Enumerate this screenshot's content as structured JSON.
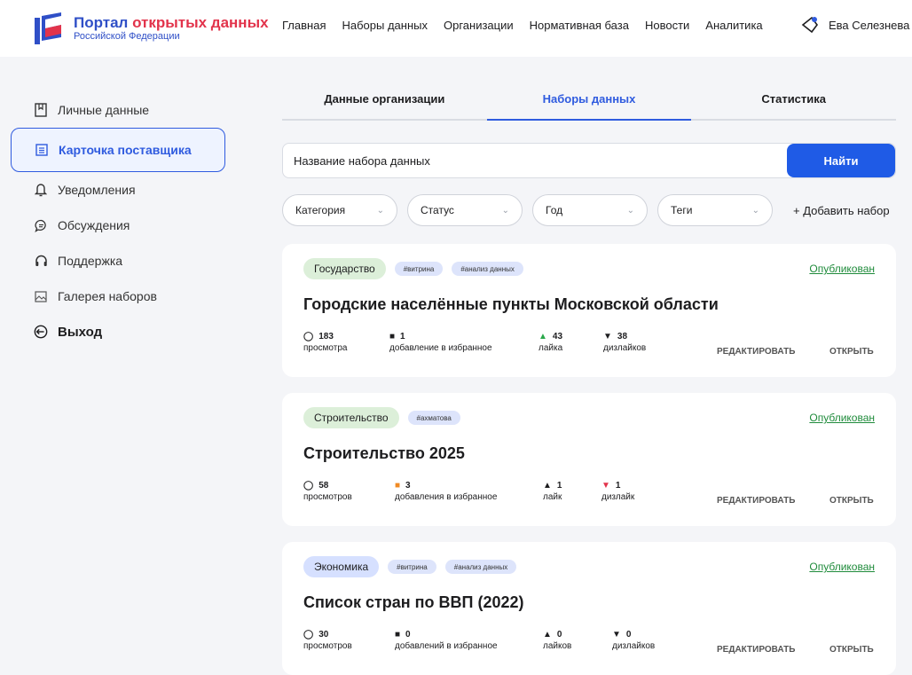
{
  "header": {
    "logo_title_main": "Портал",
    "logo_title_accent": "открытых данных",
    "logo_subtitle": "Российской Федерации",
    "nav": [
      "Главная",
      "Наборы данных",
      "Организации",
      "Нормативная база",
      "Новости",
      "Аналитика"
    ],
    "user_name": "Ева Селезнева"
  },
  "sidebar": {
    "items": [
      {
        "label": "Личные данные",
        "icon": "bookmark-doc-icon"
      },
      {
        "label": "Карточка поставщика",
        "icon": "card-icon"
      },
      {
        "label": "Уведомления",
        "icon": "bell-icon"
      },
      {
        "label": "Обсуждения",
        "icon": "chat-icon"
      },
      {
        "label": "Поддержка",
        "icon": "headset-icon"
      },
      {
        "label": "Галерея наборов",
        "icon": "gallery-icon"
      },
      {
        "label": "Выход",
        "icon": "logout-icon"
      }
    ]
  },
  "tabs": [
    "Данные организации",
    "Наборы данных",
    "Статистика"
  ],
  "search": {
    "placeholder": "Название набора данных",
    "button": "Найти"
  },
  "filters": [
    "Категория",
    "Статус",
    "Год",
    "Теги"
  ],
  "add_set": "+ Добавить набор",
  "cards": [
    {
      "category": "Государство",
      "tags": [
        "#витрина",
        "#анализ данных"
      ],
      "status": "Опубликован",
      "title": "Городские населённые пункты Московской области",
      "views": "183",
      "views_label": "просмотра",
      "favs": "1",
      "favs_label": "добавление в избранное",
      "likes": "43",
      "likes_label": "лайка",
      "dislikes": "38",
      "dislikes_label": "дизлайков",
      "edit": "РЕДАКТИРОВАТЬ",
      "open": "ОТКРЫТЬ"
    },
    {
      "category": "Строительство",
      "tags": [
        "#ахматова"
      ],
      "status": "Опубликован",
      "title": "Строительство 2025",
      "views": "58",
      "views_label": "просмотров",
      "favs": "3",
      "favs_label": "добавления в избранное",
      "likes": "1",
      "likes_label": "лайк",
      "dislikes": "1",
      "dislikes_label": "дизлайк",
      "edit": "РЕДАКТИРОВАТЬ",
      "open": "ОТКРЫТЬ"
    },
    {
      "category": "Экономика",
      "tags": [
        "#витрина",
        "#анализ данных"
      ],
      "status": "Опубликован",
      "title": "Список стран по ВВП (2022)",
      "views": "30",
      "views_label": "просмотров",
      "favs": "0",
      "favs_label": "добавлений в избранное",
      "likes": "0",
      "likes_label": "лайков",
      "dislikes": "0",
      "dislikes_label": "дизлайков",
      "edit": "РЕДАКТИРОВАТЬ",
      "open": "ОТКРЫТЬ"
    }
  ],
  "colors": {
    "accent": "#2f5bdf",
    "button": "#1f5be6",
    "status": "#1f8b3b",
    "logo_red": "#e2334b"
  }
}
